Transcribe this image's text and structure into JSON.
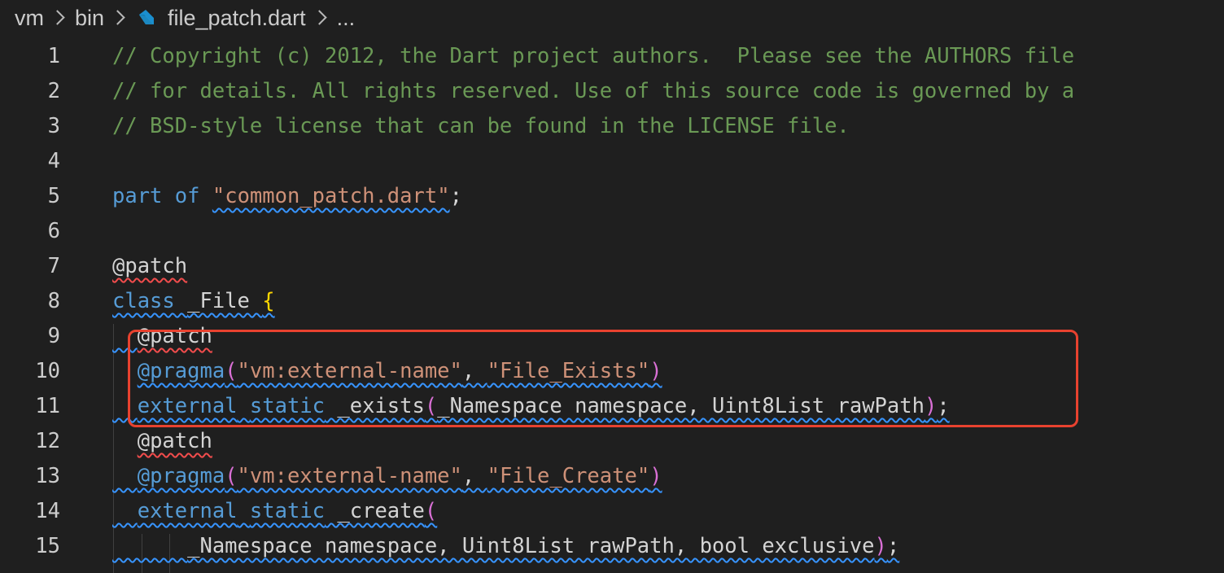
{
  "breadcrumb": {
    "items": [
      "vm",
      "bin"
    ],
    "file": "file_patch.dart",
    "more": "..."
  },
  "colors": {
    "background": "#1f1f1f",
    "comment": "#6a9955",
    "keyword": "#569cd6",
    "string": "#ce9178",
    "highlight_box": "#e8422f"
  },
  "editor": {
    "lines": [
      {
        "n": "1",
        "tokens": [
          {
            "t": "// Copyright (c) 2012, the Dart project authors.  Please see the AUTHORS file",
            "c": "cmt"
          }
        ]
      },
      {
        "n": "2",
        "tokens": [
          {
            "t": "// for details. All rights reserved. Use of this source code is governed by a",
            "c": "cmt"
          }
        ]
      },
      {
        "n": "3",
        "tokens": [
          {
            "t": "// BSD-style license that can be found in the LICENSE file.",
            "c": "cmt"
          }
        ]
      },
      {
        "n": "4",
        "tokens": []
      },
      {
        "n": "5",
        "tokens": [
          {
            "t": "part",
            "c": "kw"
          },
          {
            "t": " ",
            "c": "plain"
          },
          {
            "t": "of",
            "c": "kw"
          },
          {
            "t": " ",
            "c": "plain"
          },
          {
            "t": "\"common_patch.dart\"",
            "c": "str wavy-blue"
          },
          {
            "t": ";",
            "c": "plain"
          }
        ]
      },
      {
        "n": "6",
        "tokens": []
      },
      {
        "n": "7",
        "tokens": [
          {
            "t": "@patch",
            "c": "plain wavy-red"
          }
        ]
      },
      {
        "n": "8",
        "tokens": [
          {
            "t": "class",
            "c": "kw wavy-blue"
          },
          {
            "t": " ",
            "c": "plain wavy-blue"
          },
          {
            "t": "_File",
            "c": "plain wavy-blue"
          },
          {
            "t": " ",
            "c": "plain wavy-blue"
          },
          {
            "t": "{",
            "c": "brace wavy-blue"
          }
        ]
      },
      {
        "n": "9",
        "tokens": [
          {
            "t": "  ",
            "c": "plain wavy-blue"
          },
          {
            "t": "@patch",
            "c": "plain wavy-red"
          }
        ]
      },
      {
        "n": "10",
        "tokens": [
          {
            "t": "  ",
            "c": "plain"
          },
          {
            "t": "@pragma",
            "c": "ann wavy-blue"
          },
          {
            "t": "(",
            "c": "paren wavy-blue"
          },
          {
            "t": "\"vm:external-name\"",
            "c": "str wavy-blue"
          },
          {
            "t": ", ",
            "c": "plain wavy-blue"
          },
          {
            "t": "\"File_Exists\"",
            "c": "str wavy-blue"
          },
          {
            "t": ")",
            "c": "paren wavy-blue"
          }
        ]
      },
      {
        "n": "11",
        "tokens": [
          {
            "t": "  ",
            "c": "plain wavy-blue"
          },
          {
            "t": "external",
            "c": "kw wavy-blue"
          },
          {
            "t": " ",
            "c": "plain wavy-blue"
          },
          {
            "t": "static",
            "c": "kw wavy-blue"
          },
          {
            "t": " _exists",
            "c": "plain wavy-blue"
          },
          {
            "t": "(",
            "c": "paren wavy-blue"
          },
          {
            "t": "_Namespace namespace, Uint8List rawPath",
            "c": "plain wavy-blue"
          },
          {
            "t": ")",
            "c": "paren wavy-blue"
          },
          {
            "t": ";",
            "c": "plain wavy-blue"
          }
        ]
      },
      {
        "n": "12",
        "tokens": [
          {
            "t": "  ",
            "c": "plain"
          },
          {
            "t": "@patch",
            "c": "plain wavy-red"
          }
        ]
      },
      {
        "n": "13",
        "tokens": [
          {
            "t": "  ",
            "c": "plain wavy-blue"
          },
          {
            "t": "@pragma",
            "c": "ann wavy-blue"
          },
          {
            "t": "(",
            "c": "paren wavy-blue"
          },
          {
            "t": "\"vm:external-name\"",
            "c": "str wavy-blue"
          },
          {
            "t": ", ",
            "c": "plain wavy-blue"
          },
          {
            "t": "\"File_Create\"",
            "c": "str wavy-blue"
          },
          {
            "t": ")",
            "c": "paren wavy-blue"
          }
        ]
      },
      {
        "n": "14",
        "tokens": [
          {
            "t": "  ",
            "c": "plain wavy-blue"
          },
          {
            "t": "external",
            "c": "kw wavy-blue"
          },
          {
            "t": " ",
            "c": "plain wavy-blue"
          },
          {
            "t": "static",
            "c": "kw wavy-blue"
          },
          {
            "t": " _create",
            "c": "plain wavy-blue"
          },
          {
            "t": "(",
            "c": "paren wavy-blue"
          }
        ]
      },
      {
        "n": "15",
        "tokens": [
          {
            "t": "      ",
            "c": "plain wavy-blue"
          },
          {
            "t": "_Namespace namespace, Uint8List rawPath, bool exclusive",
            "c": "plain wavy-blue"
          },
          {
            "t": ")",
            "c": "paren wavy-blue"
          },
          {
            "t": ";",
            "c": "plain wavy-blue"
          }
        ]
      }
    ]
  }
}
